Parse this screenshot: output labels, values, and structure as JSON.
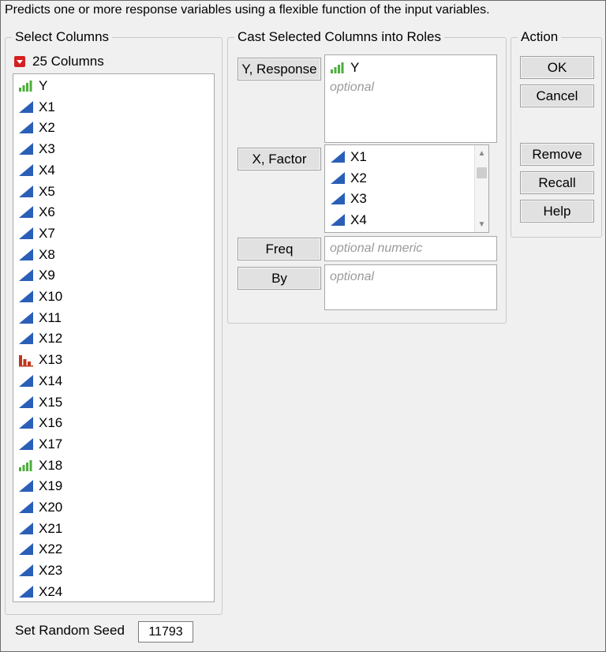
{
  "description": "Predicts one or more response variables using a flexible function of the input variables.",
  "select_columns": {
    "title": "Select Columns",
    "count_label": "25 Columns",
    "columns": [
      {
        "name": "Y",
        "icon": "continuous-ordinal-icon"
      },
      {
        "name": "X1",
        "icon": "continuous-icon"
      },
      {
        "name": "X2",
        "icon": "continuous-icon"
      },
      {
        "name": "X3",
        "icon": "continuous-icon"
      },
      {
        "name": "X4",
        "icon": "continuous-icon"
      },
      {
        "name": "X5",
        "icon": "continuous-icon"
      },
      {
        "name": "X6",
        "icon": "continuous-icon"
      },
      {
        "name": "X7",
        "icon": "continuous-icon"
      },
      {
        "name": "X8",
        "icon": "continuous-icon"
      },
      {
        "name": "X9",
        "icon": "continuous-icon"
      },
      {
        "name": "X10",
        "icon": "continuous-icon"
      },
      {
        "name": "X11",
        "icon": "continuous-icon"
      },
      {
        "name": "X12",
        "icon": "continuous-icon"
      },
      {
        "name": "X13",
        "icon": "nominal-icon"
      },
      {
        "name": "X14",
        "icon": "continuous-icon"
      },
      {
        "name": "X15",
        "icon": "continuous-icon"
      },
      {
        "name": "X16",
        "icon": "continuous-icon"
      },
      {
        "name": "X17",
        "icon": "continuous-icon"
      },
      {
        "name": "X18",
        "icon": "continuous-ordinal-icon"
      },
      {
        "name": "X19",
        "icon": "continuous-icon"
      },
      {
        "name": "X20",
        "icon": "continuous-icon"
      },
      {
        "name": "X21",
        "icon": "continuous-icon"
      },
      {
        "name": "X22",
        "icon": "continuous-icon"
      },
      {
        "name": "X23",
        "icon": "continuous-icon"
      },
      {
        "name": "X24",
        "icon": "continuous-icon"
      }
    ]
  },
  "cast_roles": {
    "title": "Cast Selected Columns into Roles",
    "y_response": {
      "button": "Y, Response",
      "items": [
        "Y"
      ],
      "placeholder": "optional"
    },
    "x_factor": {
      "button": "X, Factor",
      "items": [
        "X1",
        "X2",
        "X3",
        "X4"
      ]
    },
    "freq": {
      "button": "Freq",
      "placeholder": "optional numeric"
    },
    "by": {
      "button": "By",
      "placeholder": "optional"
    }
  },
  "action": {
    "title": "Action",
    "ok": "OK",
    "cancel": "Cancel",
    "remove": "Remove",
    "recall": "Recall",
    "help": "Help"
  },
  "random_seed": {
    "label": "Set Random Seed",
    "value": "11793"
  },
  "colors": {
    "continuous_blue": "#2a5fb8",
    "ordinal_green": "#4caf3c",
    "nominal_red": "#c0361c",
    "count_toggle_red": "#d32020"
  }
}
